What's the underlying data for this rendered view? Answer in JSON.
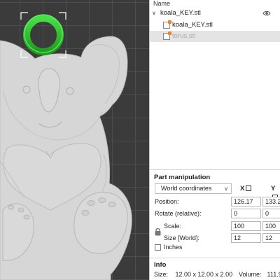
{
  "object_list": {
    "header": "Name",
    "parent": {
      "label": "koala_KEY.stl",
      "expanded": true,
      "visible_icon": "eye-icon"
    },
    "children": [
      {
        "label": "koala_KEY.stl",
        "icon": "part-icon",
        "selected": false
      },
      {
        "label": "torus.stl",
        "icon": "part-icon",
        "selected": true
      }
    ]
  },
  "part_manipulation": {
    "title": "Part manipulation",
    "coordinate_system": "World coordinates",
    "axis_x_label": "X",
    "axis_y_label": "Y",
    "position": {
      "label": "Position:",
      "x": "126.17",
      "y": "133.2"
    },
    "rotate": {
      "label": "Rotate (relative):",
      "x": "0",
      "y": "0"
    },
    "scale": {
      "label": "Scale:",
      "x": "100",
      "y": "100"
    },
    "size": {
      "label": "Size [World]:",
      "x": "12",
      "y": "12"
    },
    "inches": {
      "label": "Inches",
      "checked": false
    },
    "lock_icon": "lock-icon"
  },
  "info": {
    "title": "Info",
    "size_label": "Size:",
    "size_value": "12.00 x 12.00 x 2.00",
    "volume_label": "Volume:",
    "volume_value": "111.9"
  },
  "viewport": {
    "bed_color": "#3a3a3a",
    "grid_color": "#5a5a5a",
    "model_color": "#d7d7d7",
    "selection_color": "#2fbf2f"
  }
}
